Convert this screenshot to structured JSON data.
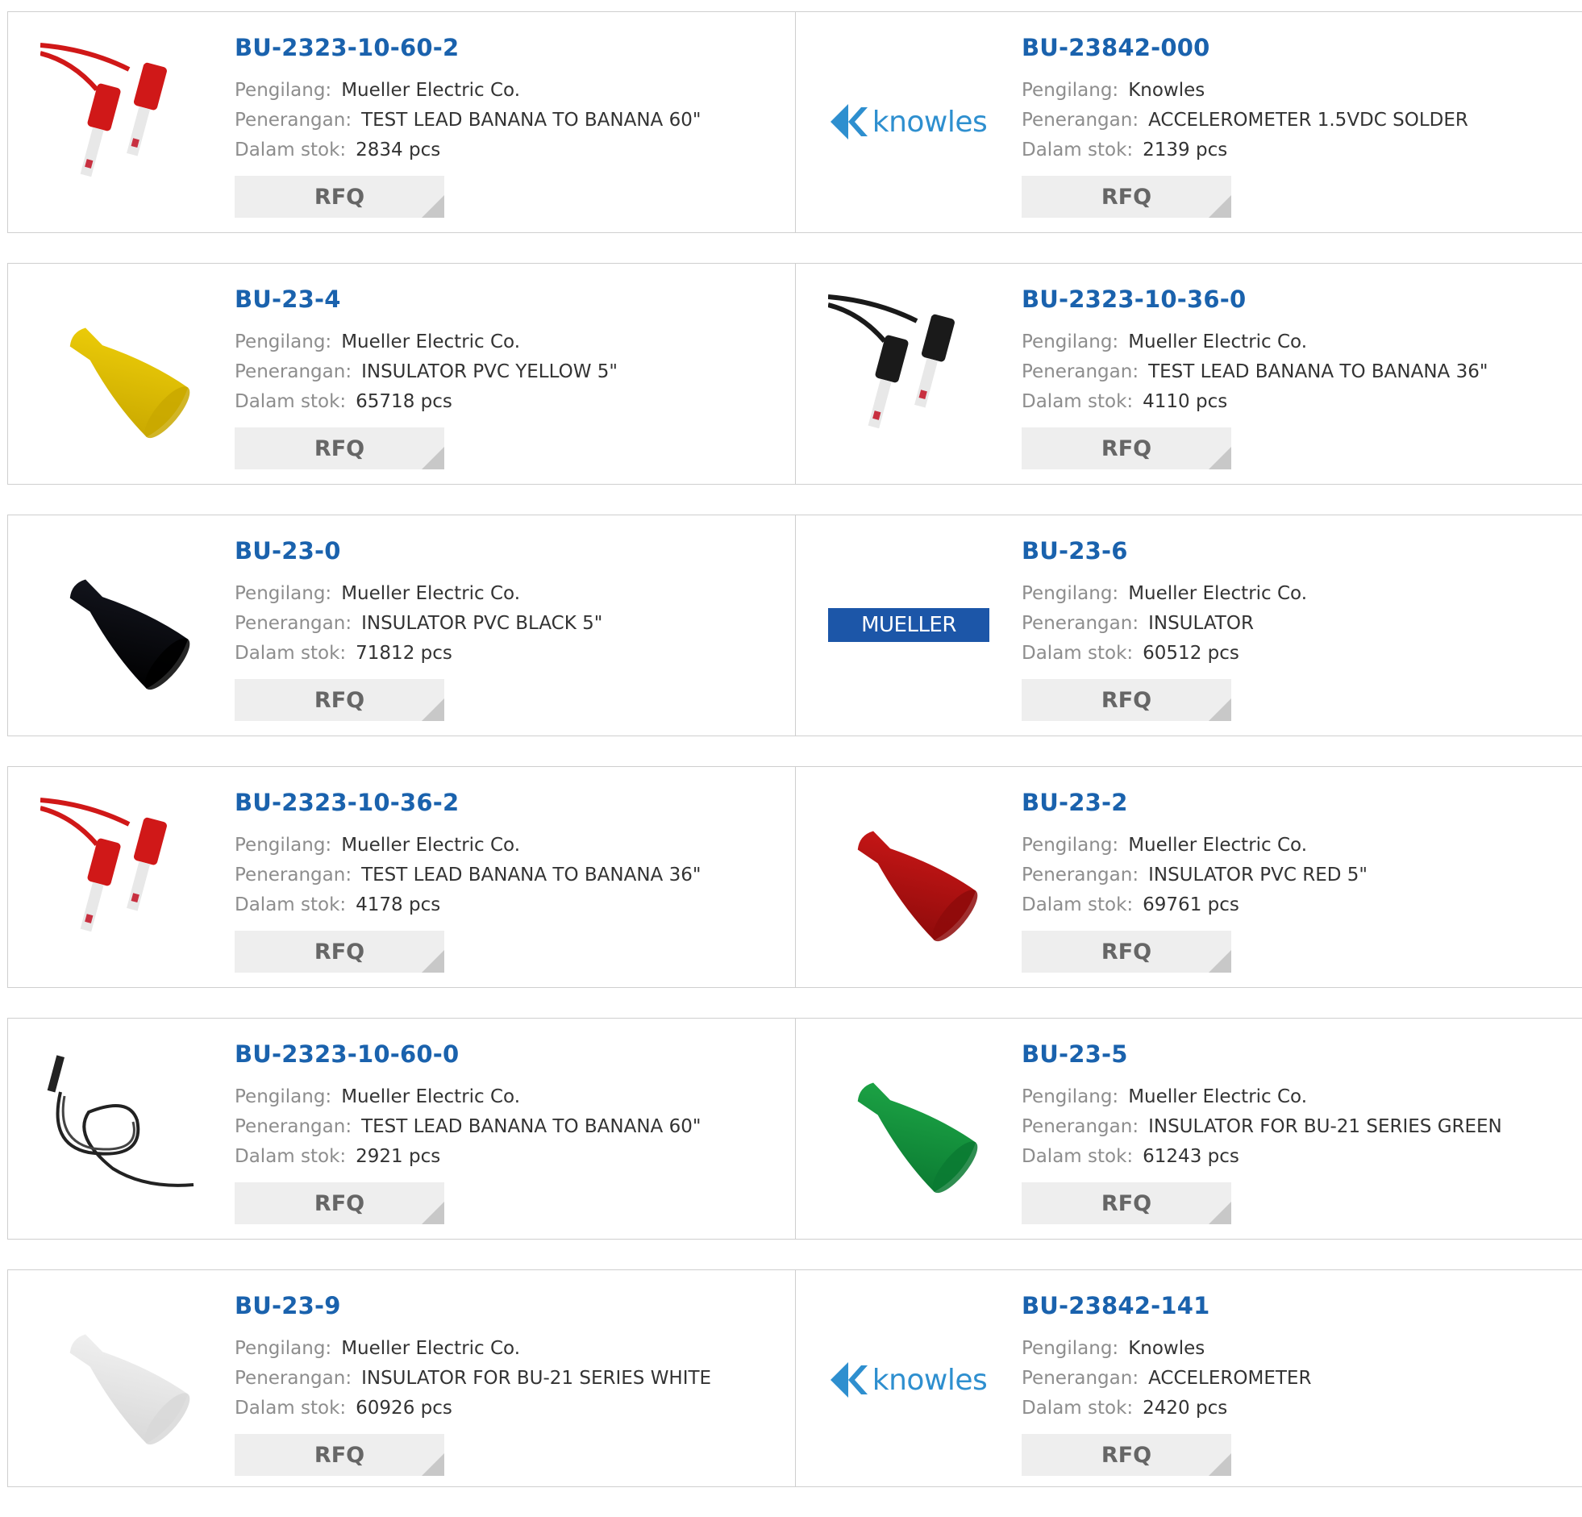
{
  "labels": {
    "manufacturer": "Pengilang:",
    "description": "Penerangan:",
    "stock": "Dalam stok:",
    "rfq": "RFQ"
  },
  "products": [
    {
      "part": "BU-2323-10-60-2",
      "manufacturer": "Mueller Electric Co.",
      "description": "TEST LEAD BANANA TO BANANA 60\"",
      "stock": "2834 pcs",
      "image": "red-test-lead"
    },
    {
      "part": "BU-23842-000",
      "manufacturer": "Knowles",
      "description": "ACCELEROMETER 1.5VDC SOLDER",
      "stock": "2139 pcs",
      "image": "knowles-logo",
      "logo_text": "knowles"
    },
    {
      "part": "BU-23-4",
      "manufacturer": "Mueller Electric Co.",
      "description": "INSULATOR PVC YELLOW 5\"",
      "stock": "65718 pcs",
      "image": "yellow-insulator"
    },
    {
      "part": "BU-2323-10-36-0",
      "manufacturer": "Mueller Electric Co.",
      "description": "TEST LEAD BANANA TO BANANA 36\"",
      "stock": "4110 pcs",
      "image": "black-test-lead"
    },
    {
      "part": "BU-23-0",
      "manufacturer": "Mueller Electric Co.",
      "description": "INSULATOR PVC BLACK 5\"",
      "stock": "71812 pcs",
      "image": "black-insulator"
    },
    {
      "part": "BU-23-6",
      "manufacturer": "Mueller Electric Co.",
      "description": "INSULATOR",
      "stock": "60512 pcs",
      "image": "mueller-logo",
      "logo_text": "MUELLER"
    },
    {
      "part": "BU-2323-10-36-2",
      "manufacturer": "Mueller Electric Co.",
      "description": "TEST LEAD BANANA TO BANANA 36\"",
      "stock": "4178 pcs",
      "image": "red-test-lead"
    },
    {
      "part": "BU-23-2",
      "manufacturer": "Mueller Electric Co.",
      "description": "INSULATOR PVC RED 5\"",
      "stock": "69761 pcs",
      "image": "red-insulator"
    },
    {
      "part": "BU-2323-10-60-0",
      "manufacturer": "Mueller Electric Co.",
      "description": "TEST LEAD BANANA TO BANANA 60\"",
      "stock": "2921 pcs",
      "image": "coiled-test-lead"
    },
    {
      "part": "BU-23-5",
      "manufacturer": "Mueller Electric Co.",
      "description": "INSULATOR FOR BU-21 SERIES GREEN",
      "stock": "61243 pcs",
      "image": "green-insulator"
    },
    {
      "part": "BU-23-9",
      "manufacturer": "Mueller Electric Co.",
      "description": "INSULATOR FOR BU-21 SERIES WHITE",
      "stock": "60926 pcs",
      "image": "white-insulator"
    },
    {
      "part": "BU-23842-141",
      "manufacturer": "Knowles",
      "description": "ACCELEROMETER",
      "stock": "2420 pcs",
      "image": "knowles-logo",
      "logo_text": "knowles"
    }
  ],
  "colors": {
    "part_link": "#1a62ad",
    "label": "#8d8d8d",
    "value": "#333333",
    "rfq_bg": "#eeeeee",
    "border": "#cfcfcf",
    "red": "#d01818",
    "yellow": "#f2d20a",
    "green": "#1faa48",
    "black": "#161822",
    "white": "#f4f4f4",
    "knowles": "#2e8fcf",
    "mueller": "#1c56a8"
  }
}
